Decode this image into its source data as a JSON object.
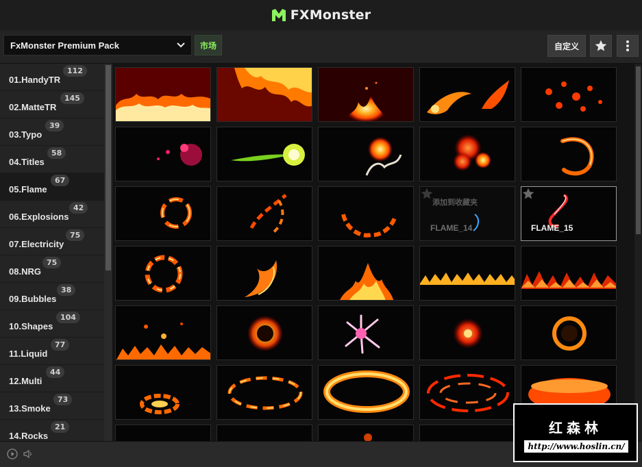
{
  "app": {
    "name_fx": "FX",
    "name_rest": "Monster"
  },
  "toolbar": {
    "pack_name": "FxMonster Premium Pack",
    "market_label": "市场",
    "custom_label": "自定义"
  },
  "sidebar": {
    "items": [
      {
        "label": "01.HandyTR",
        "count": "112"
      },
      {
        "label": "02.MatteTR",
        "count": "145"
      },
      {
        "label": "03.Typo",
        "count": "39"
      },
      {
        "label": "04.Titles",
        "count": "58"
      },
      {
        "label": "05.Flame",
        "count": "67",
        "active": true
      },
      {
        "label": "06.Explosions",
        "count": "42"
      },
      {
        "label": "07.Electricity",
        "count": "75"
      },
      {
        "label": "08.NRG",
        "count": "75"
      },
      {
        "label": "09.Bubbles",
        "count": "38"
      },
      {
        "label": "10.Shapes",
        "count": "104"
      },
      {
        "label": "11.Liquid",
        "count": "77"
      },
      {
        "label": "12.Multi",
        "count": "44"
      },
      {
        "label": "13.Smoke",
        "count": "73"
      },
      {
        "label": "14.Rocks",
        "count": "21"
      }
    ]
  },
  "grid": {
    "hovered_label": "FLAME_14",
    "hovered_fav_text": "添加到收藏夹",
    "selected_label": "FLAME_15"
  },
  "watermark": {
    "cn": "红森林",
    "url": "http://www.hoslin.cn/"
  },
  "colors": {
    "accent": "#8df25e",
    "flame_orange": "#ff6a00",
    "flame_yellow": "#ffd040",
    "flame_red": "#d11a00"
  }
}
